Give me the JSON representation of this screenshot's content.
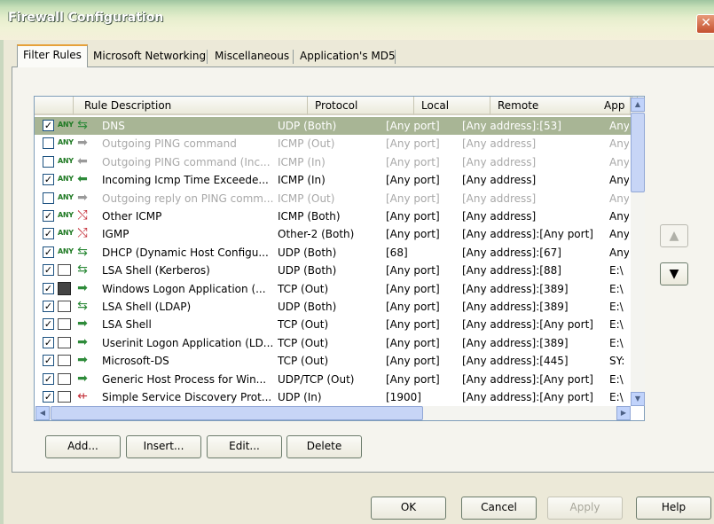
{
  "window": {
    "title": "Firewall Configuration"
  },
  "tabs": [
    {
      "label": "Filter Rules"
    },
    {
      "label": "Microsoft Networking"
    },
    {
      "label": "Miscellaneous"
    },
    {
      "label": "Application's MD5"
    }
  ],
  "columns": [
    "Rule Description",
    "Protocol",
    "Local",
    "Remote",
    "App"
  ],
  "rows": [
    {
      "checked": true,
      "desc": "DNS",
      "protocol": "UDP (Both)",
      "local": "[Any port]",
      "remote": "[Any address]:[53]",
      "app": "Any",
      "state": "selected",
      "icon": "both",
      "any": "ANY"
    },
    {
      "checked": false,
      "desc": "Outgoing PING command",
      "protocol": "ICMP (Out)",
      "local": "[Any port]",
      "remote": "[Any address]",
      "app": "Any",
      "state": "disabled",
      "icon": "out",
      "any": "ANY"
    },
    {
      "checked": false,
      "desc": "Outgoing PING command (Inc...",
      "protocol": "ICMP (In)",
      "local": "[Any port]",
      "remote": "[Any address]",
      "app": "Any",
      "state": "disabled",
      "icon": "in",
      "any": "ANY"
    },
    {
      "checked": true,
      "desc": "Incoming Icmp Time Exceede...",
      "protocol": "ICMP (In)",
      "local": "[Any port]",
      "remote": "[Any address]",
      "app": "Any",
      "state": "normal",
      "icon": "in",
      "any": "ANY"
    },
    {
      "checked": false,
      "desc": "Outgoing reply on PING comm...",
      "protocol": "ICMP (Out)",
      "local": "[Any port]",
      "remote": "[Any address]",
      "app": "Any",
      "state": "disabled",
      "icon": "out",
      "any": "ANY"
    },
    {
      "checked": true,
      "desc": "Other ICMP",
      "protocol": "ICMP (Both)",
      "local": "[Any port]",
      "remote": "[Any address]",
      "app": "Any",
      "state": "normal",
      "icon": "block",
      "any": "ANY"
    },
    {
      "checked": true,
      "desc": "IGMP",
      "protocol": "Other-2 (Both)",
      "local": "[Any port]",
      "remote": "[Any address]:[Any port]",
      "app": "Any",
      "state": "normal",
      "icon": "block",
      "any": "ANY"
    },
    {
      "checked": true,
      "desc": "DHCP (Dynamic Host Configu...",
      "protocol": "UDP (Both)",
      "local": "[68]",
      "remote": "[Any address]:[67]",
      "app": "Any",
      "state": "normal",
      "icon": "both",
      "any": "ANY"
    },
    {
      "checked": true,
      "desc": "LSA Shell (Kerberos)",
      "protocol": "UDP (Both)",
      "local": "[Any port]",
      "remote": "[Any address]:[88]",
      "app": "E:\\",
      "state": "normal",
      "icon": "both",
      "any": ""
    },
    {
      "checked": true,
      "desc": "Windows Logon Application (...",
      "protocol": "TCP (Out)",
      "local": "[Any port]",
      "remote": "[Any address]:[389]",
      "app": "E:\\",
      "state": "normal",
      "icon": "out",
      "any": "",
      "prog": true
    },
    {
      "checked": true,
      "desc": "LSA Shell (LDAP)",
      "protocol": "UDP (Both)",
      "local": "[Any port]",
      "remote": "[Any address]:[389]",
      "app": "E:\\",
      "state": "normal",
      "icon": "both",
      "any": ""
    },
    {
      "checked": true,
      "desc": "LSA Shell",
      "protocol": "TCP (Out)",
      "local": "[Any port]",
      "remote": "[Any address]:[Any port]",
      "app": "E:\\",
      "state": "normal",
      "icon": "out",
      "any": ""
    },
    {
      "checked": true,
      "desc": "Userinit Logon Application (LD...",
      "protocol": "TCP (Out)",
      "local": "[Any port]",
      "remote": "[Any address]:[389]",
      "app": "E:\\",
      "state": "normal",
      "icon": "out",
      "any": ""
    },
    {
      "checked": true,
      "desc": "Microsoft-DS",
      "protocol": "TCP (Out)",
      "local": "[Any port]",
      "remote": "[Any address]:[445]",
      "app": "SY:",
      "state": "normal",
      "icon": "out",
      "any": ""
    },
    {
      "checked": true,
      "desc": "Generic Host Process for Win...",
      "protocol": "UDP/TCP (Out)",
      "local": "[Any port]",
      "remote": "[Any address]:[Any port]",
      "app": "E:\\",
      "state": "normal",
      "icon": "out",
      "any": ""
    },
    {
      "checked": true,
      "desc": "Simple Service Discovery Prot...",
      "protocol": "UDP (In)",
      "local": "[1900]",
      "remote": "[Any address]:[Any port]",
      "app": "E:\\",
      "state": "normal",
      "icon": "blockin",
      "any": ""
    }
  ],
  "list_buttons": {
    "add": "Add...",
    "insert": "Insert...",
    "edit": "Edit...",
    "delete": "Delete"
  },
  "dialog_buttons": {
    "ok": "OK",
    "cancel": "Cancel",
    "apply": "Apply",
    "help": "Help"
  }
}
